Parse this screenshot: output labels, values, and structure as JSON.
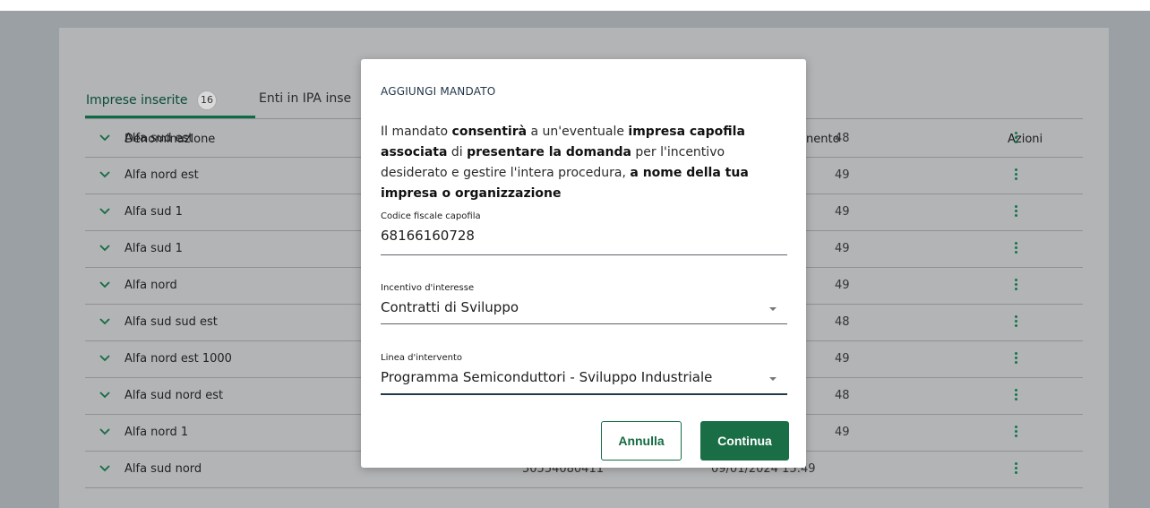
{
  "tabs": [
    {
      "label": "Imprese inserite",
      "count": "16",
      "active": true
    },
    {
      "label": "Enti in IPA inse",
      "active": false
    }
  ],
  "table": {
    "headers": [
      "Denominazione",
      "nento",
      "Azioni"
    ],
    "rows": [
      {
        "name": "Alfa sud est",
        "date": "48"
      },
      {
        "name": "Alfa nord est",
        "date": "49"
      },
      {
        "name": "Alfa sud 1",
        "date": "49"
      },
      {
        "name": "Alfa sud 1",
        "date": "49"
      },
      {
        "name": "Alfa nord",
        "date": "49"
      },
      {
        "name": "Alfa sud sud est",
        "date": "48"
      },
      {
        "name": "Alfa nord est 1000",
        "date": "49"
      },
      {
        "name": "Alfa sud nord est",
        "date": "48"
      },
      {
        "name": "Alfa nord 1",
        "date": "49"
      },
      {
        "name": "Alfa sud nord",
        "cf": "50554080411",
        "date": "09/01/2024 15:49"
      }
    ]
  },
  "modal": {
    "title": "AGGIUNGI MANDATO",
    "desc_parts": [
      "Il mandato ",
      "consentirà",
      " a un'eventuale ",
      "impresa capofila associata",
      " di ",
      "presentare la domanda",
      " per l'incentivo desiderato e gestire l'intera procedura, ",
      "a nome della tua impresa o organizzazione"
    ],
    "fields": {
      "codice_label": "Codice fiscale capofila",
      "codice_value": "68166160728",
      "incentivo_label": "Incentivo d'interesse",
      "incentivo_value": "Contratti di Sviluppo",
      "linea_label": "Linea d'intervento",
      "linea_value": "Programma Semiconduttori - Sviluppo Industriale"
    },
    "cancel_label": "Annulla",
    "continue_label": "Continua"
  },
  "colors": {
    "accent": "#1a6e46",
    "kebab": "#13764a",
    "overlay": "#9aa0a4"
  }
}
